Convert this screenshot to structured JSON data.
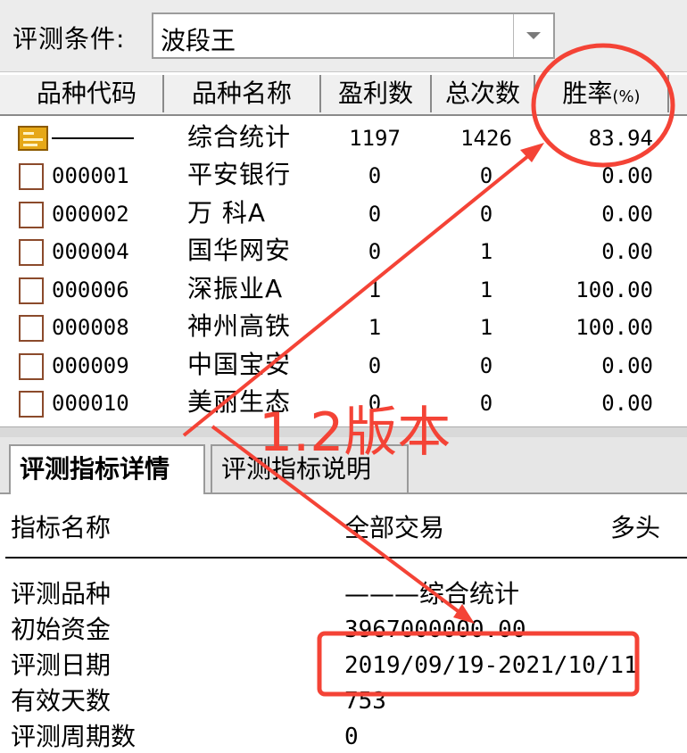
{
  "condition": {
    "label": "评测条件:",
    "value": "波段王"
  },
  "table": {
    "headers": {
      "code": "品种代码",
      "name": "品种名称",
      "profit": "盈利数",
      "total": "总次数",
      "win": "胜率",
      "win_unit": "(%)"
    },
    "summary": {
      "name": "综合统计",
      "profit": "1197",
      "total": "1426",
      "win": "83.94"
    },
    "rows": [
      {
        "code": "000001",
        "name": "平安银行",
        "profit": "0",
        "total": "0",
        "win": "0.00"
      },
      {
        "code": "000002",
        "name": "万 科A",
        "profit": "0",
        "total": "0",
        "win": "0.00"
      },
      {
        "code": "000004",
        "name": "国华网安",
        "profit": "0",
        "total": "1",
        "win": "0.00"
      },
      {
        "code": "000006",
        "name": "深振业A",
        "profit": "1",
        "total": "1",
        "win": "100.00"
      },
      {
        "code": "000008",
        "name": "神州高铁",
        "profit": "1",
        "total": "1",
        "win": "100.00"
      },
      {
        "code": "000009",
        "name": "中国宝安",
        "profit": "0",
        "total": "0",
        "win": "0.00"
      },
      {
        "code": "000010",
        "name": "美丽生态",
        "profit": "0",
        "total": "0",
        "win": "0.00"
      }
    ]
  },
  "tabs": {
    "active": "评测指标详情",
    "inactive": "评测指标说明"
  },
  "detail": {
    "col_indicator": "指标名称",
    "col_all": "全部交易",
    "col_long": "多头",
    "rows": [
      {
        "label": "评测品种",
        "value": "———综合统计"
      },
      {
        "label": "初始资金",
        "value": "3967000000.00"
      },
      {
        "label": "评测日期",
        "value": "2019/09/19-2021/10/11"
      },
      {
        "label": "有效天数",
        "value": "753"
      },
      {
        "label": "评测周期数",
        "value": "0"
      }
    ]
  },
  "annotation": {
    "text": "1.2版本",
    "color": "#f44336"
  },
  "colors": {
    "folder_icon": "#e6a817",
    "row_icon_border": "#8b4a2b",
    "header_bg": "#f0f0f0"
  }
}
